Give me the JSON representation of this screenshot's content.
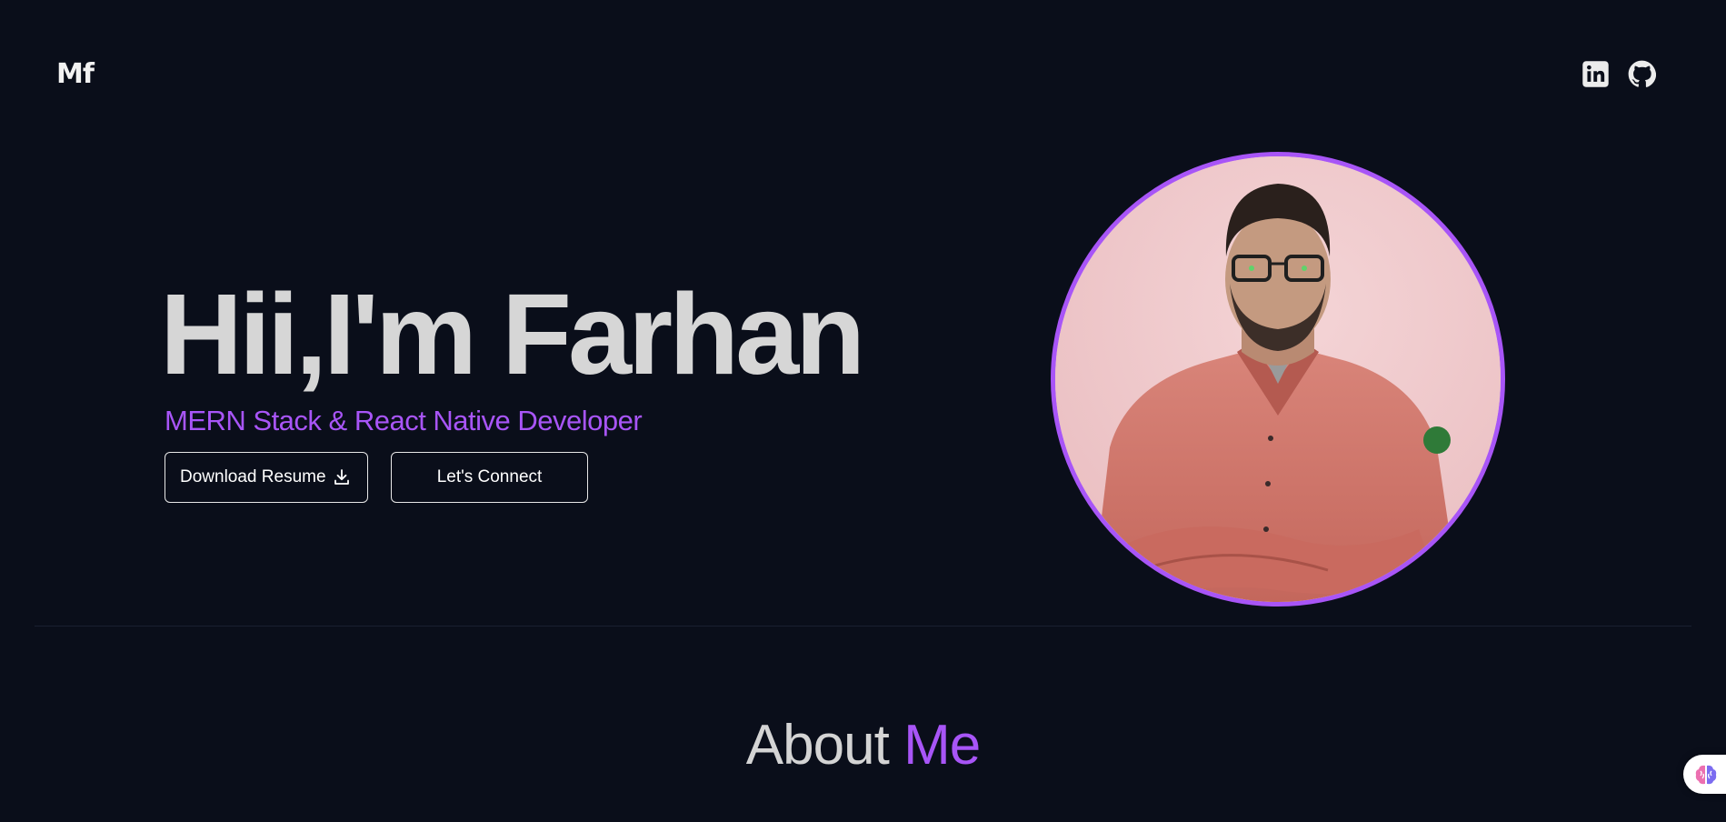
{
  "header": {
    "logo": "Mf",
    "socials": [
      {
        "icon": "linkedin-icon",
        "label": "LinkedIn"
      },
      {
        "icon": "github-icon",
        "label": "GitHub"
      }
    ]
  },
  "hero": {
    "title": "Hii,I'm Farhan",
    "subtitle": "MERN Stack & React Native Developer",
    "buttons": {
      "download_resume": "Download Resume",
      "download_icon": "download-icon",
      "connect": "Let's Connect"
    },
    "avatar": {
      "icon": "profile-photo"
    }
  },
  "about": {
    "heading_part1": "About",
    "heading_part2": "Me"
  },
  "widget": {
    "icon": "brain-icon"
  },
  "colors": {
    "background": "#0a0e1a",
    "accent": "#a855f7",
    "title_text": "#d6d6d6",
    "button_border": "#e8e8e8"
  }
}
